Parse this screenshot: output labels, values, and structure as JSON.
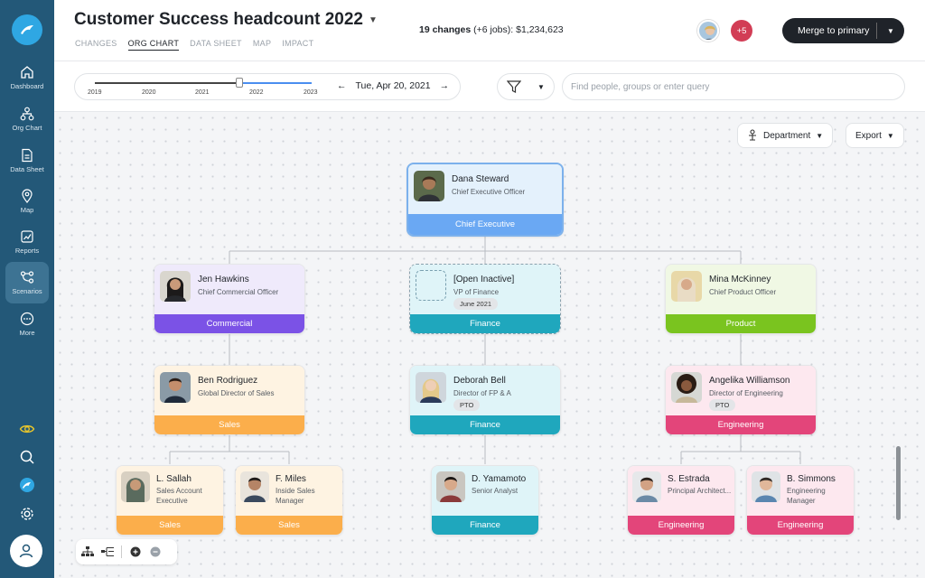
{
  "app": {
    "title": "Customer Success headcount 2022",
    "tabs": [
      "CHANGES",
      "ORG CHART",
      "DATA SHEET",
      "MAP",
      "IMPACT"
    ],
    "active_tab": "ORG CHART",
    "changes_count": "19 changes",
    "changes_detail": " (+6 jobs): $1,234,623",
    "collaborators_extra": "+5",
    "merge_label": "Merge to primary"
  },
  "sidebar": {
    "items": [
      {
        "label": "Dashboard",
        "icon": "home-icon"
      },
      {
        "label": "Org Chart",
        "icon": "org-chart-icon"
      },
      {
        "label": "Data Sheet",
        "icon": "document-icon"
      },
      {
        "label": "Map",
        "icon": "map-pin-icon"
      },
      {
        "label": "Reports",
        "icon": "reports-icon"
      },
      {
        "label": "Scenarios",
        "icon": "scenarios-icon"
      },
      {
        "label": "More",
        "icon": "more-icon"
      }
    ],
    "active": "Scenarios"
  },
  "timeline": {
    "years": [
      "2019",
      "2020",
      "2021",
      "2022",
      "2023"
    ],
    "current_date": "Tue, Apr 20, 2021"
  },
  "search": {
    "placeholder": "Find people, groups or enter query"
  },
  "canvas_controls": {
    "department_label": "Department",
    "export_label": "Export"
  },
  "org": {
    "root": {
      "name": "Dana Steward",
      "title": "Chief Executive Officer",
      "group": "Chief Executive"
    },
    "level1": [
      {
        "name": "Jen Hawkins",
        "title": "Chief Commercial Officer",
        "group": "Commercial"
      },
      {
        "name": "[Open Inactive]",
        "title": "VP of Finance",
        "badge": "June 2021",
        "group": "Finance"
      },
      {
        "name": "Mina McKinney",
        "title": "Chief Product Officer",
        "group": "Product"
      }
    ],
    "level2": [
      {
        "name": "Ben Rodriguez",
        "title": "Global Director of Sales",
        "group": "Sales"
      },
      {
        "name": "Deborah Bell",
        "title": "Director of FP & A",
        "badge": "PTO",
        "group": "Finance"
      },
      {
        "name": "Angelika Williamson",
        "title": "Director of Engineering",
        "badge": "PTO",
        "group": "Engineering"
      }
    ],
    "level3": [
      {
        "name": "L. Sallah",
        "title": "Sales Account Executive",
        "group": "Sales"
      },
      {
        "name": "F. Miles",
        "title": "Inside Sales Manager",
        "group": "Sales"
      },
      {
        "name": "D. Yamamoto",
        "title": "Senior Analyst",
        "group": "Finance"
      },
      {
        "name": "S. Estrada",
        "title": "Principal Architect...",
        "group": "Engineering"
      },
      {
        "name": "B. Simmons",
        "title": "Engineering Manager",
        "group": "Engineering"
      }
    ]
  },
  "colors": {
    "sidebar": "#235878",
    "chief_executive": "#6aa8f3",
    "commercial": "#7b52e6",
    "finance": "#1fa7bd",
    "product": "#7ac41f",
    "sales": "#fbae4b",
    "engineering": "#e3457a"
  }
}
